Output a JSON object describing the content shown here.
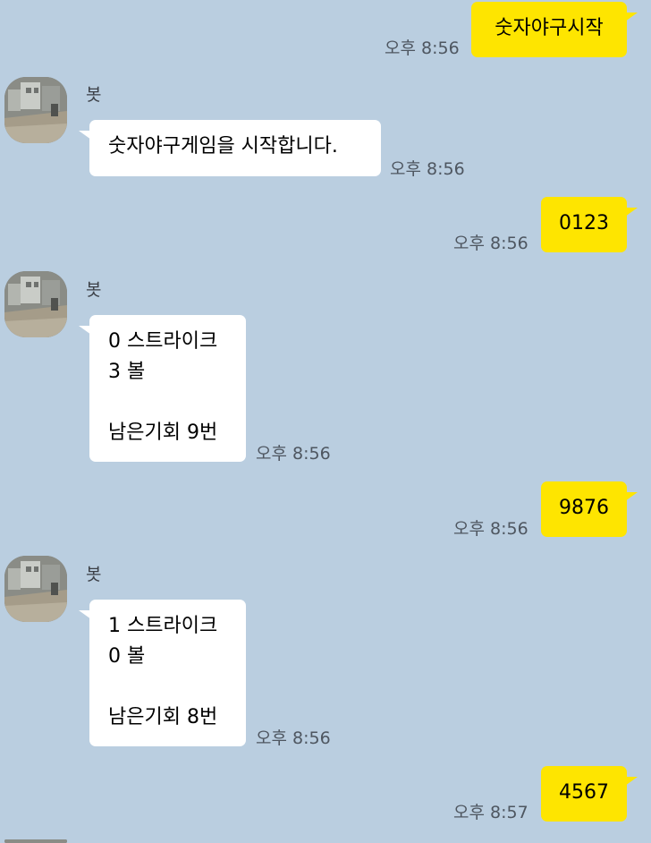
{
  "chat": {
    "messages": [
      {
        "sender": "me",
        "text": "숫자야구시작",
        "time": "오후 8:56"
      },
      {
        "sender": "bot",
        "name": "봇",
        "text": "숫자야구게임을 시작합니다.",
        "time": "오후 8:56"
      },
      {
        "sender": "me",
        "text": "0123",
        "time": "오후 8:56"
      },
      {
        "sender": "bot",
        "name": "봇",
        "text": "0 스트라이크\n3 볼\n\n남은기회 9번",
        "time": "오후 8:56"
      },
      {
        "sender": "me",
        "text": "9876",
        "time": "오후 8:56"
      },
      {
        "sender": "bot",
        "name": "봇",
        "text": "1 스트라이크\n0 볼\n\n남은기회 8번",
        "time": "오후 8:56"
      },
      {
        "sender": "me",
        "text": "4567",
        "time": "오후 8:57"
      }
    ]
  },
  "colors": {
    "background": "#bacee0",
    "my_bubble": "#fee500",
    "bot_bubble": "#ffffff",
    "time_text": "#4e5660"
  },
  "icons": {
    "bot_avatar": "bot-avatar-photo"
  }
}
